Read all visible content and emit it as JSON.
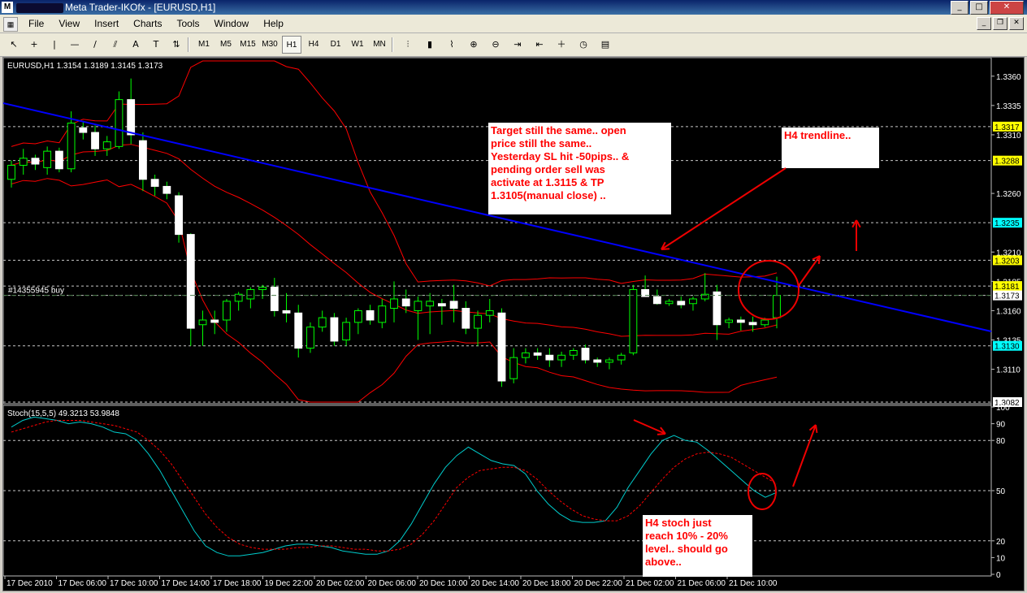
{
  "window": {
    "title": "Meta Trader-IKOfx - [EURUSD,H1]",
    "buttons": {
      "minimize": "0",
      "maximize": "1",
      "close": "r"
    }
  },
  "menu": [
    "File",
    "View",
    "Insert",
    "Charts",
    "Tools",
    "Window",
    "Help"
  ],
  "toolbar": {
    "drawing_tools": [
      {
        "name": "cursor-icon",
        "glyph": "↖"
      },
      {
        "name": "crosshair-icon",
        "glyph": "+"
      },
      {
        "name": "vertical-line-icon",
        "glyph": "|"
      },
      {
        "name": "horizontal-line-icon",
        "glyph": "—"
      },
      {
        "name": "trendline-icon",
        "glyph": "/"
      },
      {
        "name": "channel-icon",
        "glyph": "⫽"
      },
      {
        "name": "text-icon",
        "glyph": "A"
      },
      {
        "name": "label-icon",
        "glyph": "T"
      },
      {
        "name": "arrows-icon",
        "glyph": "⇅"
      }
    ],
    "timeframes": [
      "M1",
      "M5",
      "M15",
      "M30",
      "H1",
      "H4",
      "D1",
      "W1",
      "MN"
    ],
    "active_timeframe": "H1",
    "chart_tools": [
      {
        "name": "bar-chart-icon",
        "glyph": "⫶"
      },
      {
        "name": "candle-chart-icon",
        "glyph": "▮"
      },
      {
        "name": "line-chart-icon",
        "glyph": "⌇"
      },
      {
        "name": "zoom-in-icon",
        "glyph": "⊕"
      },
      {
        "name": "zoom-out-icon",
        "glyph": "⊖"
      },
      {
        "name": "autoscroll-icon",
        "glyph": "⇥"
      },
      {
        "name": "chart-shift-icon",
        "glyph": "⇤"
      },
      {
        "name": "indicators-icon",
        "glyph": "＋"
      },
      {
        "name": "periods-icon",
        "glyph": "◷"
      },
      {
        "name": "templates-icon",
        "glyph": "▤"
      }
    ]
  },
  "colors": {
    "background": "#000000",
    "bull_candle": "#ffffff",
    "bear_candle": "#ffffff",
    "wick": "#00ff00",
    "bollinger": "#ff0000",
    "trendline": "#0000ff",
    "stoch_main": "#00cccc",
    "stoch_signal": "#ff0000",
    "grid": "#c0c0c0",
    "annotation_text": "#ff0000",
    "annotation_box": "#ffffff",
    "price_highlight": "#ffff00",
    "price_current": "#00ffff"
  },
  "chart_data": [
    {
      "type": "candlestick",
      "info_label": "EURUSD,H1  1.3154 1.3189 1.3145 1.3173",
      "order_label": "#14355945 buy",
      "ylim": [
        1.3082,
        1.3373
      ],
      "y_ticks": [
        "1.3360",
        "1.3335",
        "1.3310",
        "1.3260",
        "1.3210",
        "1.3185",
        "1.3160",
        "1.3135",
        "1.3110"
      ],
      "highlight_levels": [
        {
          "label": "1.3317",
          "value": 1.3317,
          "color": "#ffff00"
        },
        {
          "label": "1.3288",
          "value": 1.3288,
          "color": "#ffff00"
        },
        {
          "label": "1.3235",
          "value": 1.3235,
          "color": "#00ffff"
        },
        {
          "label": "1.3203",
          "value": 1.3203,
          "color": "#ffff00"
        },
        {
          "label": "1.3181",
          "value": 1.3181,
          "color": "#ffff00"
        },
        {
          "label": "1.3173",
          "value": 1.3173,
          "color": "#ffffff"
        },
        {
          "label": "1.3130",
          "value": 1.313,
          "color": "#00ffff"
        },
        {
          "label": "1.3082",
          "value": 1.3082,
          "color": "#ffffff"
        }
      ],
      "candles": [
        [
          1.3272,
          1.3288,
          1.3265,
          1.3284
        ],
        [
          1.3284,
          1.3298,
          1.3276,
          1.329
        ],
        [
          1.329,
          1.3293,
          1.328,
          1.3285
        ],
        [
          1.3282,
          1.33,
          1.3276,
          1.3296
        ],
        [
          1.3296,
          1.3299,
          1.3278,
          1.3281
        ],
        [
          1.3281,
          1.333,
          1.3278,
          1.332
        ],
        [
          1.3316,
          1.3322,
          1.3306,
          1.3312
        ],
        [
          1.3312,
          1.3318,
          1.3292,
          1.3298
        ],
        [
          1.3298,
          1.3309,
          1.3292,
          1.3304
        ],
        [
          1.33,
          1.3347,
          1.3298,
          1.334
        ],
        [
          1.334,
          1.3358,
          1.3302,
          1.331
        ],
        [
          1.3305,
          1.3312,
          1.3262,
          1.3272
        ],
        [
          1.3272,
          1.3276,
          1.3258,
          1.3266
        ],
        [
          1.3266,
          1.327,
          1.3255,
          1.326
        ],
        [
          1.3258,
          1.3261,
          1.3218,
          1.3225
        ],
        [
          1.3225,
          1.3226,
          1.313,
          1.3145
        ],
        [
          1.3148,
          1.316,
          1.313,
          1.3152
        ],
        [
          1.3152,
          1.316,
          1.314,
          1.315
        ],
        [
          1.3152,
          1.317,
          1.3142,
          1.3168
        ],
        [
          1.3168,
          1.3176,
          1.316,
          1.3174
        ],
        [
          1.317,
          1.318,
          1.3162,
          1.3178
        ],
        [
          1.3178,
          1.3182,
          1.317,
          1.318
        ],
        [
          1.318,
          1.3188,
          1.3155,
          1.316
        ],
        [
          1.316,
          1.3175,
          1.315,
          1.3158
        ],
        [
          1.3158,
          1.3165,
          1.312,
          1.3128
        ],
        [
          1.3128,
          1.315,
          1.3124,
          1.3146
        ],
        [
          1.3146,
          1.316,
          1.3142,
          1.3154
        ],
        [
          1.3154,
          1.3158,
          1.313,
          1.3134
        ],
        [
          1.3135,
          1.3154,
          1.313,
          1.315
        ],
        [
          1.315,
          1.3162,
          1.314,
          1.316
        ],
        [
          1.316,
          1.3165,
          1.3148,
          1.3152
        ],
        [
          1.315,
          1.317,
          1.3145,
          1.3164
        ],
        [
          1.3162,
          1.3185,
          1.315,
          1.317
        ],
        [
          1.317,
          1.3178,
          1.3158,
          1.3164
        ],
        [
          1.316,
          1.3172,
          1.3135,
          1.3168
        ],
        [
          1.3164,
          1.3175,
          1.314,
          1.3168
        ],
        [
          1.3166,
          1.317,
          1.3148,
          1.3164
        ],
        [
          1.3168,
          1.3182,
          1.315,
          1.3162
        ],
        [
          1.3162,
          1.3168,
          1.314,
          1.3145
        ],
        [
          1.3145,
          1.316,
          1.313,
          1.3156
        ],
        [
          1.3156,
          1.317,
          1.315,
          1.316
        ],
        [
          1.3158,
          1.3162,
          1.3095,
          1.31
        ],
        [
          1.3102,
          1.3128,
          1.3098,
          1.312
        ],
        [
          1.312,
          1.3128,
          1.3115,
          1.3124
        ],
        [
          1.3124,
          1.3128,
          1.3118,
          1.3122
        ],
        [
          1.3122,
          1.3128,
          1.3112,
          1.3118
        ],
        [
          1.3118,
          1.3125,
          1.3112,
          1.3122
        ],
        [
          1.3122,
          1.3128,
          1.3118,
          1.3126
        ],
        [
          1.3128,
          1.3131,
          1.3115,
          1.3118
        ],
        [
          1.3118,
          1.312,
          1.3112,
          1.3116
        ],
        [
          1.3116,
          1.312,
          1.311,
          1.3118
        ],
        [
          1.3118,
          1.3124,
          1.3114,
          1.3122
        ],
        [
          1.3124,
          1.3182,
          1.3122,
          1.3178
        ],
        [
          1.3178,
          1.319,
          1.3172,
          1.3172
        ],
        [
          1.3172,
          1.3178,
          1.3165,
          1.3166
        ],
        [
          1.3166,
          1.317,
          1.3164,
          1.3168
        ],
        [
          1.3168,
          1.3172,
          1.3162,
          1.3165
        ],
        [
          1.3166,
          1.3172,
          1.316,
          1.317
        ],
        [
          1.317,
          1.3192,
          1.3168,
          1.3174
        ],
        [
          1.3176,
          1.3182,
          1.3135,
          1.3148
        ],
        [
          1.315,
          1.3154,
          1.3145,
          1.3152
        ],
        [
          1.3152,
          1.3155,
          1.3143,
          1.315
        ],
        [
          1.315,
          1.3155,
          1.3142,
          1.3148
        ],
        [
          1.3148,
          1.3154,
          1.3146,
          1.3152
        ],
        [
          1.3154,
          1.3189,
          1.3145,
          1.3173
        ]
      ]
    },
    {
      "type": "line",
      "indicator_label": "Stoch(15,5,5) 49.3213 53.9848",
      "ylim": [
        0,
        100
      ],
      "y_ticks": [
        "100",
        "90",
        "80",
        "50",
        "20",
        "10",
        "0"
      ],
      "x_ticks": [
        "17 Dec 2010",
        "17 Dec 06:00",
        "17 Dec 10:00",
        "17 Dec 14:00",
        "17 Dec 18:00",
        "19 Dec 22:00",
        "20 Dec 02:00",
        "20 Dec 06:00",
        "20 Dec 10:00",
        "20 Dec 14:00",
        "20 Dec 18:00",
        "20 Dec 22:00",
        "21 Dec 02:00",
        "21 Dec 06:00",
        "21 Dec 10:00"
      ],
      "series": [
        {
          "color": "#00cccc",
          "values": [
            88,
            92,
            94,
            93,
            92,
            90,
            91,
            90,
            88,
            85,
            84,
            80,
            72,
            62,
            50,
            38,
            26,
            17,
            13,
            11,
            11,
            12,
            13,
            15,
            17,
            18,
            18,
            17,
            16,
            14,
            13,
            12,
            12,
            14,
            20,
            30,
            42,
            54,
            64,
            71,
            76,
            72,
            68,
            66,
            65,
            60,
            50,
            42,
            36,
            32,
            31,
            31,
            32,
            40,
            52,
            62,
            72,
            80,
            83,
            80,
            79,
            74,
            68,
            62,
            56,
            50,
            46,
            49
          ]
        },
        {
          "color": "#ff0000",
          "values": [
            85,
            87,
            89,
            91,
            92,
            92,
            92,
            91,
            90,
            89,
            87,
            85,
            80,
            74,
            66,
            56,
            46,
            36,
            28,
            22,
            18,
            16,
            15,
            15,
            15,
            16,
            16,
            17,
            17,
            16,
            15,
            15,
            14,
            14,
            15,
            18,
            24,
            32,
            42,
            52,
            58,
            62,
            63,
            64,
            64,
            62,
            57,
            50,
            44,
            39,
            35,
            33,
            32,
            32,
            35,
            41,
            49,
            57,
            64,
            69,
            72,
            73,
            72,
            70,
            66,
            62,
            58,
            54
          ]
        }
      ]
    }
  ],
  "annotations": {
    "note_main": [
      "Target still the same.. open",
      "price still the same..",
      "Yesterday SL hit -50pips.. &",
      "pending order sell was",
      "activate at 1.3115 & TP",
      "1.3105(manual close) .."
    ],
    "note_trend": "H4 trendline..",
    "note_stoch": [
      "H4 stoch just",
      "reach 10% - 20%",
      "level.. should go",
      "above.."
    ]
  }
}
